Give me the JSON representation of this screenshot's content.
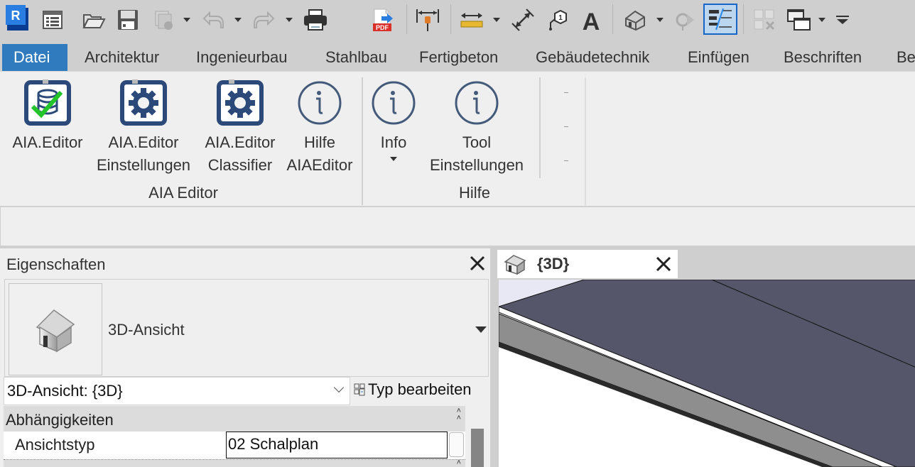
{
  "quick_access": {
    "app_logo": "R",
    "items": [
      {
        "name": "revit-home",
        "icon": "app-logo-icon"
      },
      {
        "name": "project-browser",
        "icon": "window-list-icon"
      },
      {
        "name": "open",
        "icon": "folder-open-icon"
      },
      {
        "name": "save",
        "icon": "floppy-disk-icon"
      },
      {
        "name": "sync",
        "icon": "sync-central-icon",
        "disabled": true,
        "dropdown": true
      },
      {
        "name": "undo",
        "icon": "undo-icon",
        "disabled": true,
        "dropdown": true
      },
      {
        "name": "redo",
        "icon": "redo-icon",
        "disabled": true,
        "dropdown": true
      },
      {
        "name": "print",
        "icon": "printer-icon"
      },
      {
        "name": "export-pdf",
        "icon": "pdf-export-icon"
      },
      {
        "name": "measure",
        "icon": "measure-pin-icon"
      },
      {
        "name": "aligned-dimension",
        "icon": "dimension-ruler-icon",
        "dropdown": true
      },
      {
        "name": "spot-dimension",
        "icon": "diagonal-dimension-icon"
      },
      {
        "name": "tag",
        "icon": "tag-icon"
      },
      {
        "name": "text",
        "icon": "text-icon"
      },
      {
        "name": "3d-view",
        "icon": "house-3d-icon",
        "dropdown": true
      },
      {
        "name": "section",
        "icon": "section-icon",
        "disabled": true
      },
      {
        "name": "thin-lines",
        "icon": "thin-lines-icon",
        "active": true
      },
      {
        "name": "close-hidden-windows",
        "icon": "close-windows-icon",
        "disabled": true
      },
      {
        "name": "switch-windows",
        "icon": "switch-windows-icon",
        "dropdown": true
      },
      {
        "name": "customize",
        "icon": "customize-qat-icon"
      }
    ]
  },
  "ribbon_tabs": [
    {
      "label": "Datei",
      "active": true
    },
    {
      "label": "Architektur"
    },
    {
      "label": "Ingenieurbau"
    },
    {
      "label": "Stahlbau"
    },
    {
      "label": "Fertigbeton"
    },
    {
      "label": "Gebäudetechnik"
    },
    {
      "label": "Einfügen"
    },
    {
      "label": "Beschriften"
    },
    {
      "label": "Be"
    }
  ],
  "ribbon": {
    "groups": [
      {
        "label": "AIA Editor",
        "buttons": [
          {
            "line1": "AIA.Editor",
            "line2": "",
            "icon": "database-check-icon"
          },
          {
            "line1": "AIA.Editor",
            "line2": "Einstellungen",
            "icon": "gear-settings-icon"
          },
          {
            "line1": "AIA.Editor",
            "line2": "Classifier",
            "icon": "gear-classifier-icon"
          },
          {
            "line1": "Hilfe",
            "line2": "AIAEditor",
            "icon": "info-icon"
          }
        ]
      },
      {
        "label": "Hilfe",
        "buttons": [
          {
            "line1": "Info",
            "line2": "",
            "icon": "info-icon",
            "dropdown": true
          },
          {
            "line1": "Tool",
            "line2": "Einstellungen",
            "icon": "info-icon"
          }
        ]
      }
    ]
  },
  "properties": {
    "title": "Eigenschaften",
    "type_name": "3D-Ansicht",
    "instance_selector": "3D-Ansicht: {3D}",
    "edit_type_label": "Typ bearbeiten",
    "groups": [
      {
        "label": "Abhängigkeiten",
        "rows": [
          {
            "name": "Ansichtstyp",
            "value": "02 Schalplan"
          }
        ]
      }
    ]
  },
  "view": {
    "tab_label": "{3D}",
    "colors": {
      "top_face": "#555669",
      "edge_face": "#8e8e8e",
      "shadow_edge": "#2a2a2a",
      "sky": "#e8e8f4"
    }
  },
  "colors": {
    "accent": "#2f7bbd",
    "icon_blue": "#2b4a7a",
    "check_green": "#22c42a"
  }
}
